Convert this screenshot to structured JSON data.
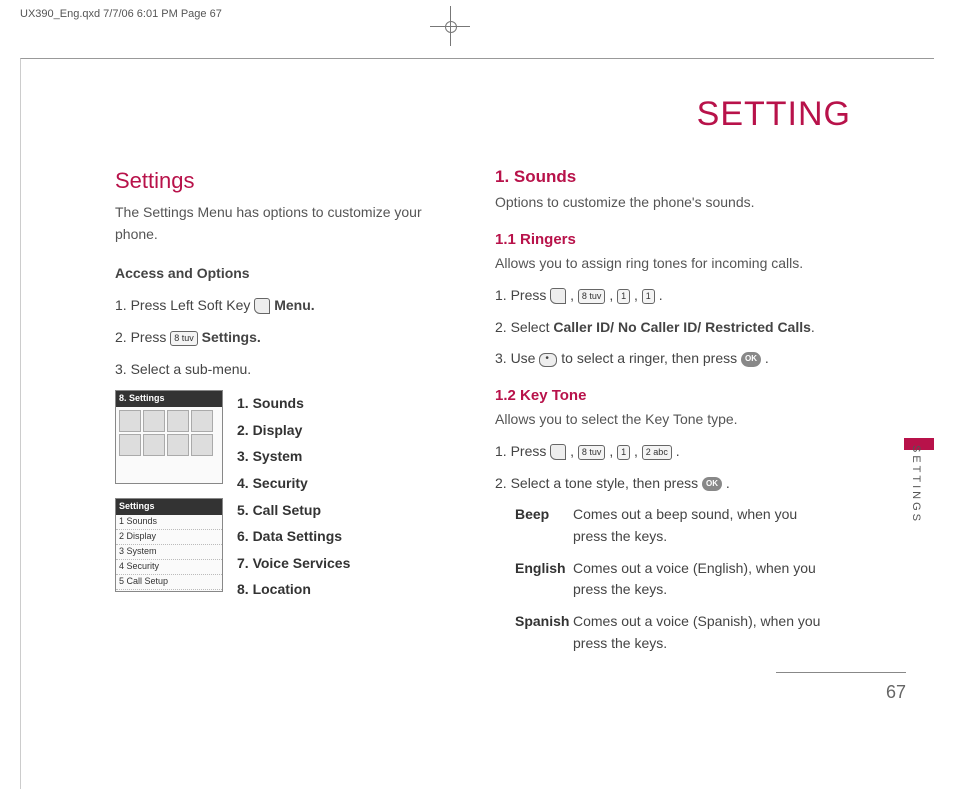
{
  "print_header": "UX390_Eng.qxd  7/7/06  6:01 PM  Page 67",
  "section_title": "SETTING",
  "left": {
    "title": "Settings",
    "intro": "The Settings Menu has options to customize your phone.",
    "access_heading": "Access and Options",
    "step1_a": "1. Press Left Soft Key ",
    "step1_b": " Menu.",
    "step2_a": "2. Press ",
    "step2_key": "8 tuv",
    "step2_b": " Settings.",
    "step3": "3. Select a sub-menu.",
    "screen1_title": "8. Settings",
    "screen2_title": "Settings",
    "screen2_items": [
      "1 Sounds",
      "2 Display",
      "3 System",
      "4 Security",
      "5 Call Setup"
    ],
    "submenu": [
      "1. Sounds",
      "2. Display",
      "3. System",
      "4. Security",
      "5. Call Setup",
      "6. Data Settings",
      "7. Voice Services",
      "8. Location"
    ]
  },
  "right": {
    "h1": "1. Sounds",
    "h1_desc": "Options to customize the phone's sounds.",
    "h11": "1.1 Ringers",
    "h11_desc": "Allows you to assign ring tones for incoming calls.",
    "r_step1_a": "1. Press ",
    "r_keys1": [
      "8 tuv",
      "1",
      "1"
    ],
    "r_step2": "2. Select Caller ID/ No Caller ID/ Restricted Calls.",
    "r_step2_plain_a": "2. Select ",
    "r_step2_bold": "Caller ID/ No Caller ID/ Restricted Calls",
    "r_step2_plain_b": ".",
    "r_step3_a": "3. Use ",
    "r_step3_b": " to select a ringer, then press ",
    "r_step3_c": ".",
    "ok_label": "OK",
    "h12": "1.2 Key Tone",
    "h12_desc": "Allows you to select the Key Tone type.",
    "k_step1_a": "1. Press ",
    "k_keys1": [
      "8 tuv",
      "1",
      "2 abc"
    ],
    "k_step2_a": "2. Select a tone style, then press ",
    "k_step2_b": ".",
    "tones": [
      {
        "label": "Beep",
        "desc": "Comes out a beep sound, when you press the keys."
      },
      {
        "label": "English",
        "desc": "Comes out a voice (English), when you press the keys."
      },
      {
        "label": "Spanish",
        "desc": "Comes out a voice (Spanish), when you press the keys."
      }
    ]
  },
  "side_tab": "SETTINGS",
  "page_number": "67"
}
